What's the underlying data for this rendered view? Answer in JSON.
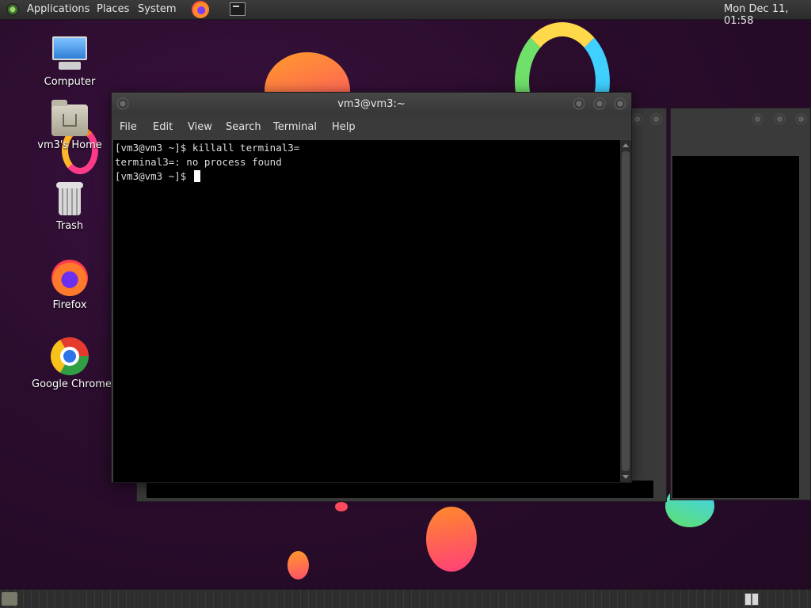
{
  "top_panel": {
    "menu_applications": "Applications",
    "menu_places": "Places",
    "menu_system": "System",
    "launcher_firefox": "firefox-icon",
    "launcher_terminal": "terminal-icon",
    "clock": "Mon Dec 11, 01:58"
  },
  "desktop": {
    "icons": [
      {
        "label": "Computer",
        "icon": "computer-icon"
      },
      {
        "label": "vm3's Home",
        "icon": "home-folder-icon"
      },
      {
        "label": "Trash",
        "icon": "trash-icon"
      },
      {
        "label": "Firefox",
        "icon": "firefox-icon"
      },
      {
        "label": "Google Chrome",
        "icon": "chrome-icon"
      }
    ]
  },
  "terminal": {
    "title": "vm3@vm3:~",
    "menu": [
      "File",
      "Edit",
      "View",
      "Search",
      "Terminal",
      "Help"
    ],
    "lines": [
      "[vm3@vm3 ~]$ killall terminal3=",
      "terminal3=: no process found",
      "[vm3@vm3 ~]$ "
    ]
  },
  "bottom_panel": {
    "show_desktop": "show-desktop-icon",
    "workspace_switcher": "workspace-switcher-icon"
  }
}
